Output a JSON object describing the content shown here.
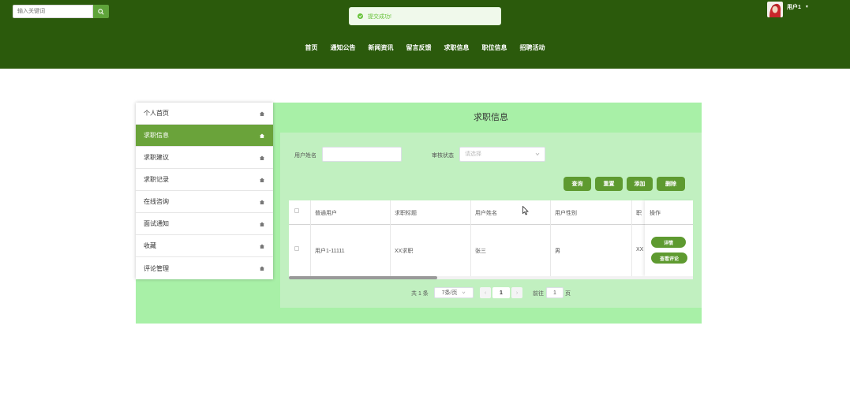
{
  "header": {
    "search": {
      "placeholder": "输入关键词"
    },
    "toast": {
      "text": "提交成功!"
    },
    "user": {
      "name": "用户1"
    },
    "nav": [
      "首页",
      "通知公告",
      "新闻资讯",
      "留言反馈",
      "求职信息",
      "职位信息",
      "招聘活动"
    ]
  },
  "sidebar": {
    "items": [
      {
        "label": "个人首页",
        "active": false
      },
      {
        "label": "求职信息",
        "active": true
      },
      {
        "label": "求职建议",
        "active": false
      },
      {
        "label": "求职记录",
        "active": false
      },
      {
        "label": "在线咨询",
        "active": false
      },
      {
        "label": "面试通知",
        "active": false
      },
      {
        "label": "收藏",
        "active": false
      },
      {
        "label": "评论管理",
        "active": false
      }
    ]
  },
  "main": {
    "title": "求职信息",
    "filters": {
      "name_label": "用户姓名",
      "status_label": "审核状态",
      "status_placeholder": "请选择"
    },
    "buttons": {
      "query": "查询",
      "reset": "重置",
      "add": "添加",
      "delete": "删除"
    },
    "table": {
      "headers": [
        "普通用户",
        "求职标题",
        "用户姓名",
        "用户性别",
        "职",
        "操作"
      ],
      "rows": [
        {
          "user": "用户1-11111",
          "title": "XX求职",
          "name": "张三",
          "gender": "男",
          "job": "XX",
          "ops": [
            "详情",
            "查看评论"
          ]
        }
      ]
    },
    "pagination": {
      "total": "共 1 条",
      "page_size": "7条/页",
      "current_page": "1",
      "goto_label": "前往",
      "goto_value": "1",
      "page_unit": "页"
    }
  },
  "colors": {
    "header_bg": "#2b5a0c",
    "accent": "#5e9a30",
    "panel_bg": "#c1f0c0",
    "outer_bg": "#a8f0a7"
  }
}
